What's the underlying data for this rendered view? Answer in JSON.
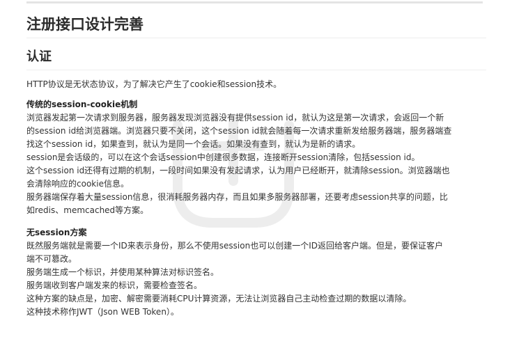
{
  "heading": "注册接口设计完善",
  "subheading": "认证",
  "intro": "HTTP协议是无状态协议，为了解决它产生了cookie和session技术。",
  "sections": [
    {
      "title": "传统的session-cookie机制",
      "lines": [
        "浏览器发起第一次请求到服务器，服务器发现浏览器没有提供session id，就认为这是第一次请求，会返回一个新",
        "的session id给浏览器端。浏览器只要不关闭，这个session id就会随着每一次请求重新发给服务器端，服务器端查",
        "找这个session id，如果查到，就认为是同一个会话。如果没有查到，就认为是新的请求。",
        "session是会话级的，可以在这个会话session中创建很多数据，连接断开session清除，包括session id。",
        "这个session id还得有过期的机制，一段时间如果没有发起请求，认为用户已经断开，就清除session。浏览器端也",
        "会清除响应的cookie信息。",
        "服务器端保存着大量session信息，很消耗服务器内存，而且如果多服务器部署，还要考虑session共享的问题，比",
        "如redis、memcached等方案。"
      ]
    },
    {
      "title": "无session方案",
      "lines": [
        "既然服务端就是需要一个ID来表示身份，那么不使用session也可以创建一个ID返回给客户端。但是，要保证客户",
        "端不可篡改。",
        "服务端生成一个标识，并使用某种算法对标识签名。",
        "服务端收到客户端发来的标识，需要检查签名。",
        "这种方案的缺点是，加密、解密需要消耗CPU计算资源，无法让浏览器自己主动检查过期的数据以清除。",
        "这种技术称作JWT（Json WEB Token）。"
      ]
    }
  ],
  "watermark": {
    "icon": "watermark-logo-icon",
    "color": "#7a7a7a"
  }
}
